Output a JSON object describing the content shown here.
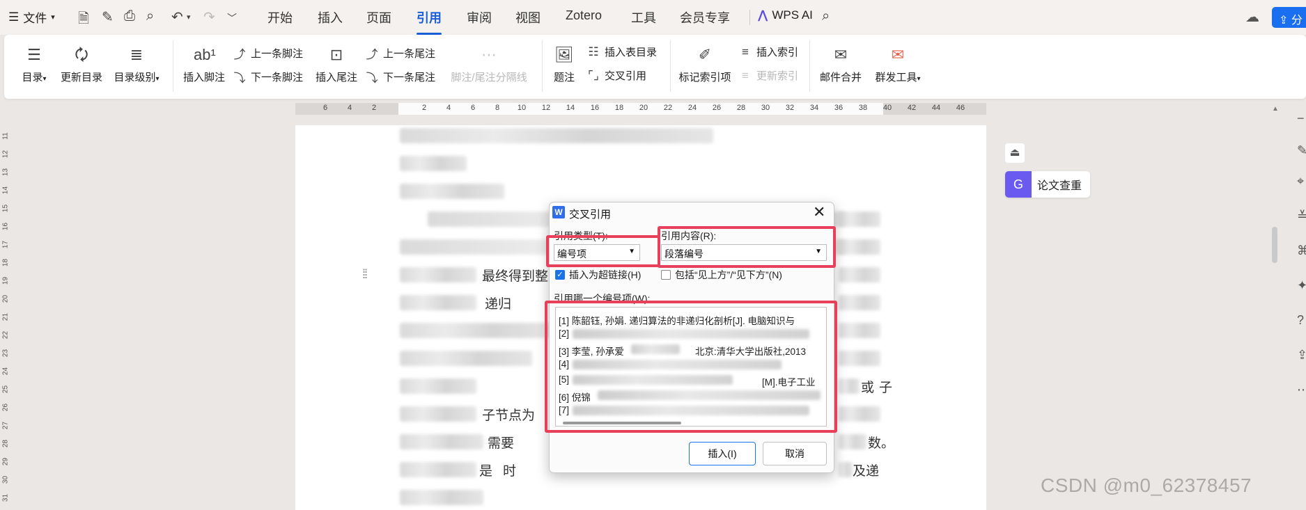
{
  "menubar": {
    "file_label": "文件",
    "tabs": [
      "开始",
      "插入",
      "页面",
      "引用",
      "审阅",
      "视图",
      "Zotero",
      "工具",
      "会员专享"
    ],
    "active_tab": "引用",
    "wps_ai_label": "WPS AI",
    "share_label": "分"
  },
  "ribbon": {
    "toc": "目录",
    "update_toc": "更新目录",
    "toc_level": "目录级别",
    "insert_footnote": "插入脚注",
    "prev_footnote": "上一条脚注",
    "next_footnote": "下一条脚注",
    "insert_endnote": "插入尾注",
    "prev_endnote": "上一条尾注",
    "next_endnote": "下一条尾注",
    "separator": "脚注/尾注分隔线",
    "caption": "题注",
    "insert_table_of_figures": "插入表目录",
    "cross_reference": "交叉引用",
    "mark_index": "标记索引项",
    "insert_index": "插入索引",
    "update_index": "更新索引",
    "mail_merge": "邮件合并",
    "mass_send": "群发工具"
  },
  "ruler_ticks": [
    "6",
    "4",
    "2",
    "2",
    "4",
    "6",
    "8",
    "10",
    "12",
    "14",
    "16",
    "18",
    "20",
    "22",
    "24",
    "26",
    "28",
    "30",
    "32",
    "34",
    "36",
    "38",
    "40",
    "42",
    "44",
    "46"
  ],
  "vruler_ticks": [
    "11",
    "12",
    "13",
    "14",
    "15",
    "16",
    "17",
    "18",
    "19",
    "20",
    "21",
    "22",
    "23",
    "24",
    "25",
    "26",
    "27",
    "28",
    "29",
    "30",
    "31"
  ],
  "doc_fragments": {
    "f1": "最终得到整",
    "f2": "递归",
    "f3": "子节点为",
    "f4": "需要",
    "f5": "数。",
    "f6": "是",
    "f7": "时",
    "f8": "及递",
    "f9": "或",
    "f10": "子"
  },
  "side_panel": {
    "paper_check_label": "论文查重"
  },
  "watermark": "CSDN @m0_62378457",
  "dialog": {
    "title": "交叉引用",
    "ref_type_label": "引用类型(T):",
    "ref_type_value": "编号项",
    "ref_content_label": "引用内容(R):",
    "ref_content_value": "段落编号",
    "insert_hyperlink_label": "插入为超链接(H)",
    "insert_hyperlink_checked": true,
    "include_above_below_label": "包括“见上方”/“见下方”(N)",
    "include_above_below_checked": false,
    "which_item_label": "引用哪一个编号项(W):",
    "items": [
      "[1] 陈韶钰, 孙娟. 递归算法的非递归化剖析[J]. 电脑知识与",
      "[2]",
      "[3] 李莹, 孙承爱",
      "北京:清华大学出版社,2013",
      "[4]",
      "[5]",
      "[M].电子工业",
      "[6] 倪锦",
      "[7]"
    ],
    "insert_button": "插入(I)",
    "cancel_button": "取消"
  }
}
